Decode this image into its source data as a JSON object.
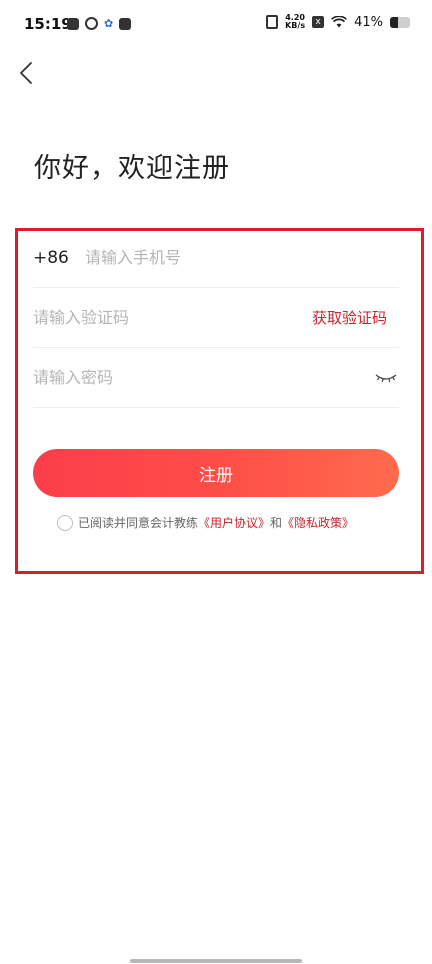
{
  "status_bar": {
    "time": "15:19",
    "net_speed_value": "4.20",
    "net_speed_unit": "KB/s",
    "x_glyph": "x",
    "battery_percent": "41%",
    "battery_level": 0.41,
    "icons": [
      "gallery-icon",
      "app-ring-icon",
      "baidu-paw-icon",
      "notification-app-icon",
      "vibrate-icon",
      "sim-icon",
      "wifi-icon",
      "battery-icon"
    ]
  },
  "header": {
    "back_icon": "chevron-left-icon"
  },
  "page": {
    "title": "你好，欢迎注册"
  },
  "form": {
    "phone": {
      "country_code": "+86",
      "placeholder": "请输入手机号",
      "value": ""
    },
    "code": {
      "placeholder": "请输入验证码",
      "value": "",
      "get_code_label": "获取验证码"
    },
    "password": {
      "placeholder": "请输入密码",
      "value": "",
      "toggle_icon": "eye-closed-icon"
    },
    "register_label": "注册"
  },
  "agreement": {
    "prefix": "已阅读并同意会计教练",
    "user_agreement": "《用户协议》",
    "and": "和",
    "privacy_policy": "《隐私政策》",
    "checked": false
  },
  "colors": {
    "accent": "#c8232f",
    "button_start": "#fb3e4a",
    "button_end": "#ff6b4d",
    "highlight_frame": "#e01c2c"
  }
}
